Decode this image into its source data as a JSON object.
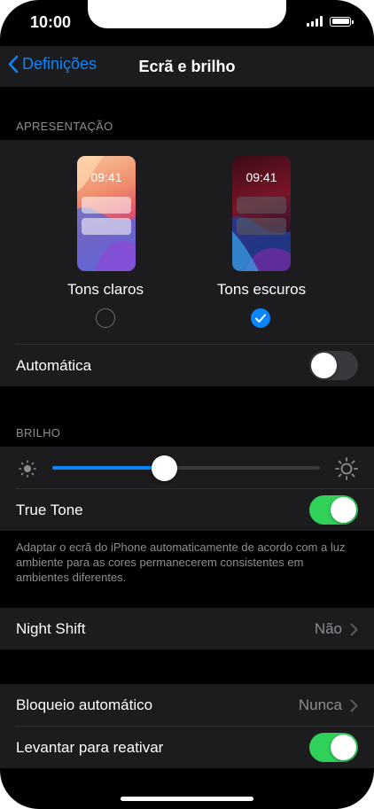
{
  "status_bar": {
    "time": "10:00"
  },
  "nav": {
    "back_label": "Definições",
    "title": "Ecrã e brilho"
  },
  "appearance": {
    "header": "APRESENTAÇÃO",
    "light": {
      "time": "09:41",
      "label": "Tons claros",
      "selected": false
    },
    "dark": {
      "time": "09:41",
      "label": "Tons escuros",
      "selected": true
    },
    "automatic": {
      "label": "Automática",
      "on": false
    }
  },
  "brightness": {
    "header": "BRILHO",
    "level": 0.42,
    "true_tone": {
      "label": "True Tone",
      "on": true
    },
    "note": "Adaptar o ecrã do iPhone automaticamente de acordo com a luz ambiente para as cores permanecerem consistentes em ambientes diferentes."
  },
  "night_shift": {
    "label": "Night Shift",
    "value": "Não"
  },
  "lock": {
    "auto_lock": {
      "label": "Bloqueio automático",
      "value": "Nunca"
    },
    "raise_to_wake": {
      "label": "Levantar para reativar",
      "on": true
    }
  },
  "colors": {
    "accent": "#0a84ff",
    "toggle_on": "#30d158",
    "background": "#000000",
    "cell": "#1c1c1e"
  }
}
